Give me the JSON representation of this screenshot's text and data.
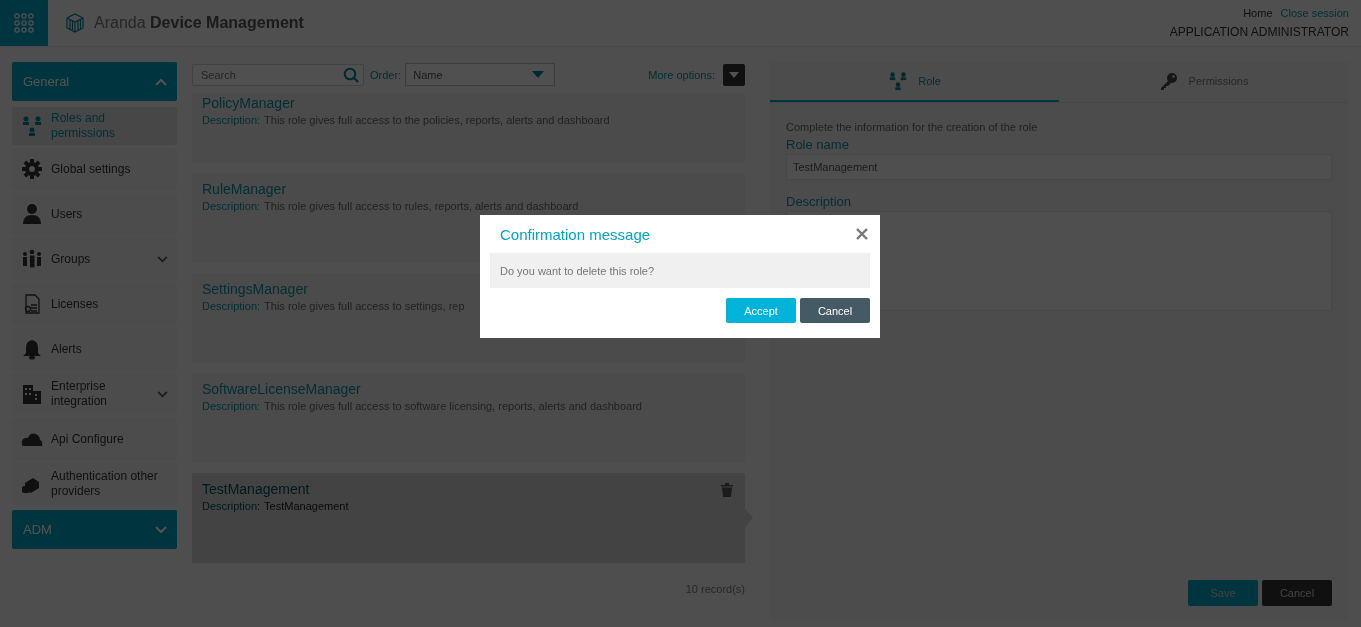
{
  "header": {
    "app_title": "Aranda **Device Management**",
    "links": [
      {
        "label": "Home",
        "kind": "plain"
      },
      {
        "label": "Close session",
        "kind": "accent"
      }
    ],
    "user_role": "APPLICATION ADMINISTRATOR"
  },
  "sidebar": {
    "sections": [
      {
        "label": "General",
        "expanded": true,
        "items": [
          {
            "label": "Roles and permissions",
            "selected": true,
            "expandable": false
          },
          {
            "label": "Global settings",
            "selected": false,
            "expandable": false
          },
          {
            "label": "Users",
            "selected": false,
            "expandable": false
          },
          {
            "label": "Groups",
            "selected": false,
            "expandable": true
          },
          {
            "label": "Licenses",
            "selected": false,
            "expandable": false
          },
          {
            "label": "Alerts",
            "selected": false,
            "expandable": false
          },
          {
            "label": "Enterprise integration",
            "selected": false,
            "expandable": true
          },
          {
            "label": "Api Configure",
            "selected": false,
            "expandable": false
          },
          {
            "label": "Authentication other providers",
            "selected": false,
            "expandable": false
          }
        ]
      },
      {
        "label": "ADM",
        "expanded": false
      }
    ]
  },
  "toolbar": {
    "search": {
      "placeholder": "Search"
    },
    "order_label": "Order:",
    "order_value": "Name",
    "more_options": "More options:"
  },
  "roles": [
    {
      "name": "PolicyManager",
      "description_label": "Description:",
      "description": "This role gives full access to the policies, reports, alerts and dashboard",
      "selected": false
    },
    {
      "name": "RuleManager",
      "description_label": "Description:",
      "description": "This role gives full access to rules, reports, alerts and dashboard",
      "selected": false
    },
    {
      "name": "SettingsManager",
      "description_label": "Description:",
      "description": "This role gives full access to settings, rep",
      "selected": false
    },
    {
      "name": "SoftwareLicenseManager",
      "description_label": "Description:",
      "description": "This role gives full access to software licensing, reports, alerts and dashboard",
      "selected": false
    },
    {
      "name": "TestManagement",
      "description_label": "Description:",
      "description": "TestManagement",
      "selected": true
    }
  ],
  "records": "10 record(s)",
  "detail": {
    "tabs": [
      {
        "label": "Role",
        "selected": true
      },
      {
        "label": "Permissions",
        "selected": false
      }
    ],
    "intro": "Complete the information for the creation of the role",
    "role_name_label": "Role name",
    "role_name_value": "TestManagement",
    "description_label": "Description",
    "buttons": [
      {
        "label": "Save",
        "kind": "primary"
      },
      {
        "label": "Cancel",
        "kind": "dark"
      }
    ]
  },
  "dialog": {
    "title": "Confirmation message",
    "message": "Do you want to delete this role?",
    "buttons": [
      {
        "label": "Accept",
        "kind": "primary"
      },
      {
        "label": "Cancel",
        "kind": "secondary"
      }
    ]
  }
}
